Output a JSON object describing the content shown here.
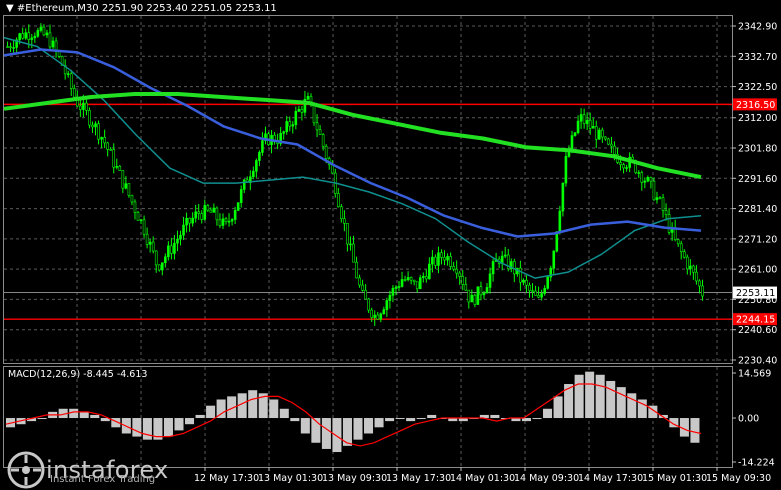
{
  "header": {
    "symbol_timeframe": "#Ethereum,M30",
    "ohlc": "2251.90 2253.40 2251.05 2253.11"
  },
  "watermark": {
    "name": "instaforex",
    "tagline": "Instant Forex Trading"
  },
  "colors": {
    "background": "#000000",
    "grid": "#5a5a5a",
    "candle": "#00ff00",
    "ma_fast": "#0f8f8f",
    "ma_mid": "#3a5fdc",
    "ma_slow": "#22e022",
    "level_line": "#ff0000",
    "macd_hist": "#c8c8c8",
    "macd_signal": "#ff0000"
  },
  "chart_data": [
    {
      "type": "candlestick",
      "symbol": "#Ethereum",
      "timeframe": "M30",
      "ylim": [
        2226,
        2348
      ],
      "y_ticks": [
        "2342.90",
        "2332.70",
        "2322.50",
        "2312.00",
        "2301.80",
        "2291.60",
        "2281.40",
        "2271.20",
        "2261.00",
        "2250.80",
        "2240.60",
        "2230.40"
      ],
      "x_ticks": [
        "12 May 17:30",
        "13 May 01:30",
        "13 May 09:30",
        "13 May 17:30",
        "14 May 01:30",
        "14 May 09:30",
        "14 May 17:30",
        "15 May 01:30",
        "15 May 09:30"
      ],
      "price_tags": [
        {
          "label": "2316.50",
          "value": 2316.5,
          "bg": "#ff0000"
        },
        {
          "label": "2253.11",
          "value": 2253.11,
          "bg": "#ffffff"
        },
        {
          "label": "2244.15",
          "value": 2244.15,
          "bg": "#ff0000"
        }
      ],
      "horizontal_levels": [
        2316.5,
        2244.15
      ],
      "close_path": [
        2336,
        2340,
        2341,
        2339,
        2330,
        2318,
        2312,
        2305,
        2295,
        2285,
        2275,
        2262,
        2268,
        2275,
        2280,
        2280,
        2275,
        2285,
        2296,
        2305,
        2305,
        2312,
        2318,
        2305,
        2290,
        2270,
        2252,
        2245,
        2252,
        2258,
        2255,
        2262,
        2266,
        2262,
        2250,
        2255,
        2265,
        2262,
        2255,
        2250,
        2265,
        2298,
        2312,
        2308,
        2302,
        2298,
        2296,
        2290,
        2282,
        2270,
        2262,
        2253
      ],
      "ma_fast": [
        2339,
        2336,
        2328,
        2318,
        2306,
        2295,
        2290,
        2290,
        2291,
        2292,
        2290,
        2287,
        2283,
        2278,
        2270,
        2263,
        2258,
        2260,
        2266,
        2274,
        2278,
        2279
      ],
      "ma_mid": [
        2333,
        2335,
        2334,
        2329,
        2322,
        2316,
        2309,
        2305,
        2303,
        2296,
        2290,
        2285,
        2279,
        2275,
        2272,
        2273,
        2276,
        2277,
        2275,
        2274
      ],
      "ma_slow": [
        2315,
        2317,
        2319,
        2320,
        2320,
        2319,
        2318,
        2317,
        2313,
        2310,
        2307,
        2305,
        2302,
        2301,
        2299,
        2295,
        2292
      ]
    },
    {
      "type": "macd",
      "label": "MACD(12,26,9) -8.445 -4.613",
      "y_ticks": [
        "14.569",
        "0.00",
        "-14.224"
      ],
      "ylim": [
        -16,
        18
      ],
      "histogram": [
        -3,
        -2,
        -1,
        0,
        2,
        3,
        3,
        2,
        1,
        -1,
        -3,
        -5,
        -6,
        -7,
        -7,
        -6,
        -4,
        -2,
        1,
        4,
        6,
        7,
        8,
        9,
        8,
        6,
        3,
        -1,
        -5,
        -8,
        -10,
        -11,
        -9,
        -7,
        -5,
        -3,
        -1,
        0,
        -1,
        0,
        1,
        0,
        -1,
        -1,
        0,
        1,
        1,
        0,
        -1,
        -1,
        0,
        3,
        7,
        11,
        14,
        15,
        14,
        12,
        10,
        8,
        6,
        4,
        1,
        -3,
        -6,
        -8
      ],
      "signal": [
        -2,
        -1,
        0,
        1,
        1,
        2,
        2,
        1,
        -1,
        -3,
        -5,
        -6,
        -6,
        -5,
        -3,
        -1,
        2,
        4,
        6,
        7,
        7,
        5,
        2,
        -2,
        -5,
        -8,
        -9,
        -8,
        -6,
        -4,
        -2,
        -1,
        0,
        0,
        0,
        0,
        -1,
        0,
        0,
        3,
        6,
        9,
        11,
        11,
        10,
        8,
        6,
        4,
        1,
        -2,
        -4,
        -5
      ]
    }
  ]
}
